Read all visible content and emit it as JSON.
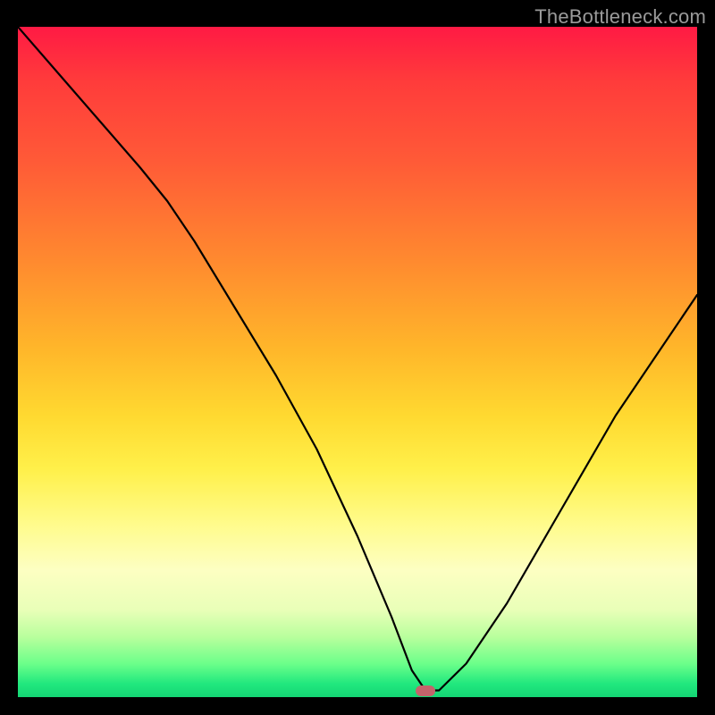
{
  "watermark": "TheBottleneck.com",
  "marker": {
    "x_pct": 60,
    "y_pct": 99
  },
  "chart_data": {
    "type": "line",
    "title": "",
    "xlabel": "",
    "ylabel": "",
    "xlim": [
      0,
      100
    ],
    "ylim": [
      0,
      100
    ],
    "series": [
      {
        "name": "bottleneck-curve",
        "x": [
          0,
          6,
          12,
          18,
          22,
          26,
          32,
          38,
          44,
          50,
          55,
          58,
          60,
          62,
          66,
          72,
          80,
          88,
          96,
          100
        ],
        "y": [
          100,
          93,
          86,
          79,
          74,
          68,
          58,
          48,
          37,
          24,
          12,
          4,
          1,
          1,
          5,
          14,
          28,
          42,
          54,
          60
        ]
      }
    ],
    "background_gradient": {
      "top": "#ff1a44",
      "mid": "#ffe84a",
      "bottom": "#14d574"
    }
  }
}
